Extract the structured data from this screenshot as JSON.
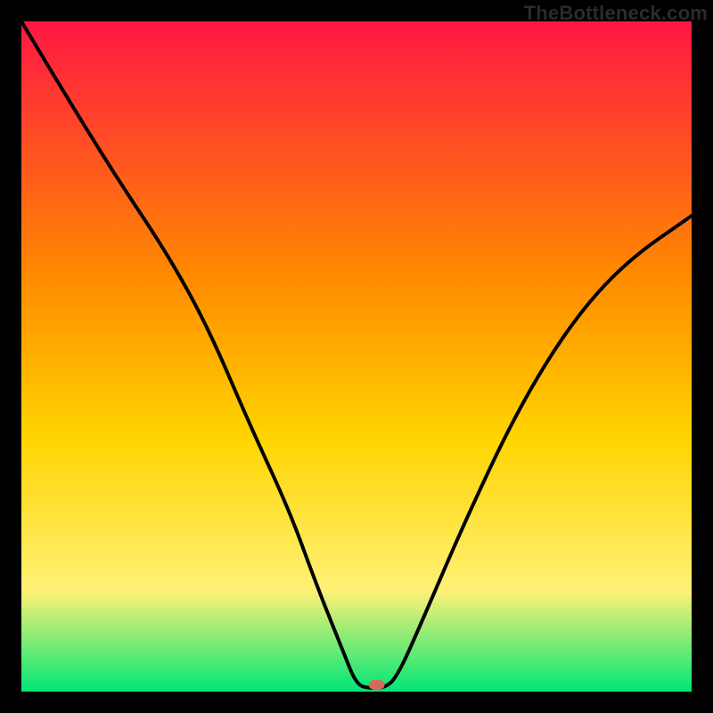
{
  "watermark": "TheBottleneck.com",
  "chart_data": {
    "type": "line",
    "title": "",
    "xlabel": "",
    "ylabel": "",
    "xlim": [
      0,
      100
    ],
    "ylim": [
      0,
      100
    ],
    "grid": false,
    "legend": false,
    "gradient_colors": {
      "top": "#ff1744",
      "mid_upper": "#ff8a00",
      "mid": "#ffd400",
      "mid_lower": "#fff176",
      "bottom": "#00e676"
    },
    "marker": {
      "x": 53,
      "y": 1,
      "color": "#d46a5a"
    },
    "series": [
      {
        "name": "bottleneck-curve",
        "x": [
          0,
          6,
          14,
          22,
          28,
          34,
          40,
          44,
          48,
          50,
          52,
          54,
          56,
          60,
          66,
          74,
          82,
          90,
          100
        ],
        "y": [
          100,
          90,
          77,
          65,
          54,
          40,
          27,
          16,
          6,
          1,
          0.5,
          0.5,
          2,
          11,
          25,
          42,
          55,
          64,
          71
        ]
      }
    ],
    "annotations": []
  }
}
